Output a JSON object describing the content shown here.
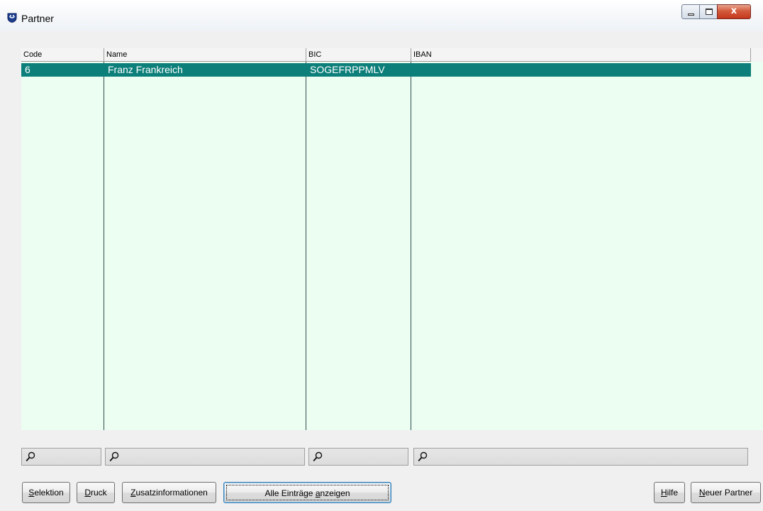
{
  "window": {
    "title": "Partner",
    "close_glyph": "x"
  },
  "grid": {
    "columns": [
      "Code",
      "Name",
      "BIC",
      "IBAN"
    ],
    "rows": [
      {
        "code": "6",
        "name": "Franz Frankreich",
        "bic": "SOGEFRPPMLV",
        "iban": ""
      }
    ],
    "selected_row_color": "#0d7f7a",
    "background_color": "#ecfdf1"
  },
  "search": {
    "icon": "magnifier-icon"
  },
  "buttons": {
    "selektion": {
      "first": "S",
      "rest": "elektion"
    },
    "druck": {
      "first": "D",
      "rest": "ruck"
    },
    "zusatz": {
      "first": "Z",
      "rest": "usatzinformationen"
    },
    "alle": {
      "before": "Alle Einträge ",
      "underlined": "a",
      "after": "nzeigen"
    },
    "hilfe": {
      "first": "H",
      "rest": "ilfe"
    },
    "neu": {
      "first": "N",
      "rest": "euer Partner"
    }
  }
}
